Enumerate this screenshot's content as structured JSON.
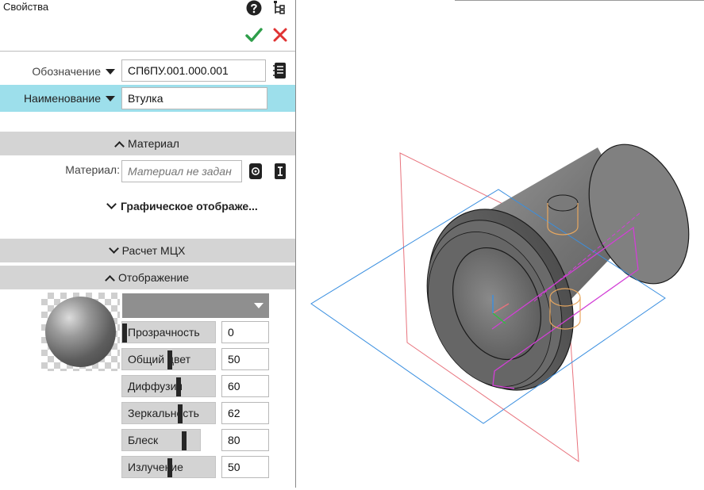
{
  "panel": {
    "title": "Свойства",
    "help_icon": "question-circle-icon",
    "tree_icon": "tree-structure-icon",
    "confirm_icon": "checkmark-icon",
    "cancel_icon": "cross-icon"
  },
  "fields": {
    "designation_label": "Обозначение",
    "designation_value": "СП6ПУ.001.000.001",
    "name_label": "Наименование",
    "name_value": "Втулка"
  },
  "sections": {
    "material": "Материал",
    "graphic": "Графическое отображе...",
    "mcx": "Расчет МЦХ",
    "display": "Отображение"
  },
  "material": {
    "label": "Материал:",
    "placeholder": "Материал не задан"
  },
  "display": {
    "sliders": [
      {
        "label": "Прозрачность",
        "value": "0",
        "percent": 0
      },
      {
        "label": "Общий цвет",
        "value": "50",
        "percent": 50
      },
      {
        "label": "Диффузия",
        "value": "60",
        "percent": 60
      },
      {
        "label": "Зеркальность",
        "value": "62",
        "percent": 62
      },
      {
        "label": "Блеск",
        "value": "80",
        "percent": 80
      },
      {
        "label": "Излучение",
        "value": "50",
        "percent": 50
      }
    ]
  },
  "colors": {
    "highlight_row": "#9ddfeb",
    "section_bar": "#d4d4d4",
    "confirm": "#2e9e4a",
    "cancel": "#e03333",
    "plane_front": "#e8737d",
    "plane_top": "#3a8fe0",
    "sketch": "#d23fd6",
    "holes": "#e8a860"
  }
}
